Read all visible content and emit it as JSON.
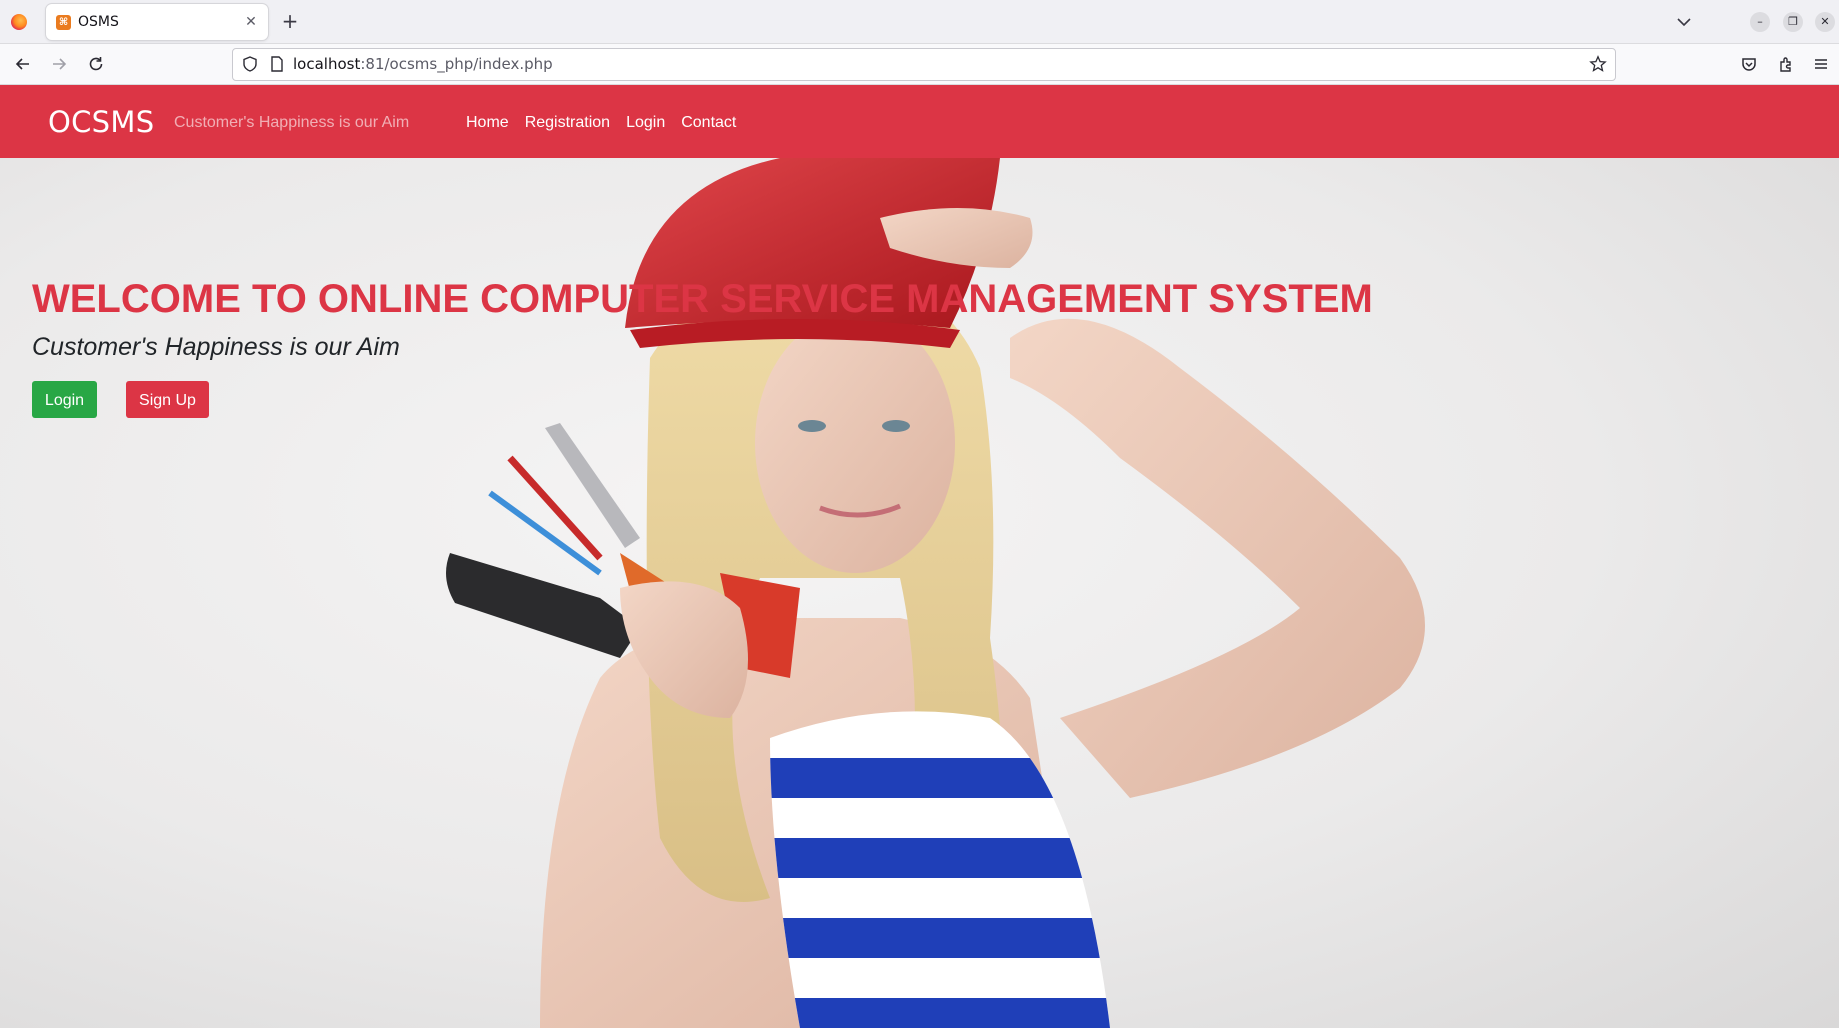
{
  "browser": {
    "tab_title": "OSMS",
    "tab_favicon_glyph": "⌘",
    "url_host": "localhost",
    "url_rest": ":81/ocsms_php/index.php",
    "icons": [
      "firefox-logo",
      "close-icon",
      "plus-icon",
      "chevron-down-icon",
      "minimize-icon",
      "restore-icon",
      "close-window-icon",
      "back-arrow-icon",
      "forward-arrow-icon",
      "reload-icon",
      "shield-icon",
      "page-icon",
      "star-icon",
      "pocket-icon",
      "extensions-icon",
      "menu-icon"
    ]
  },
  "site": {
    "brand": "OCSMS",
    "tagline": "Customer's Happiness is our Aim",
    "nav": [
      "Home",
      "Registration",
      "Login",
      "Contact"
    ],
    "header_color": "#dc3545"
  },
  "hero": {
    "title": "WELCOME TO ONLINE COMPUTER SERVICE MANAGEMENT SYSTEM",
    "subtitle": "Customer's Happiness is our Aim",
    "login_label": "Login",
    "signup_label": "Sign Up",
    "login_color": "#28a745",
    "signup_color": "#dc3545"
  }
}
